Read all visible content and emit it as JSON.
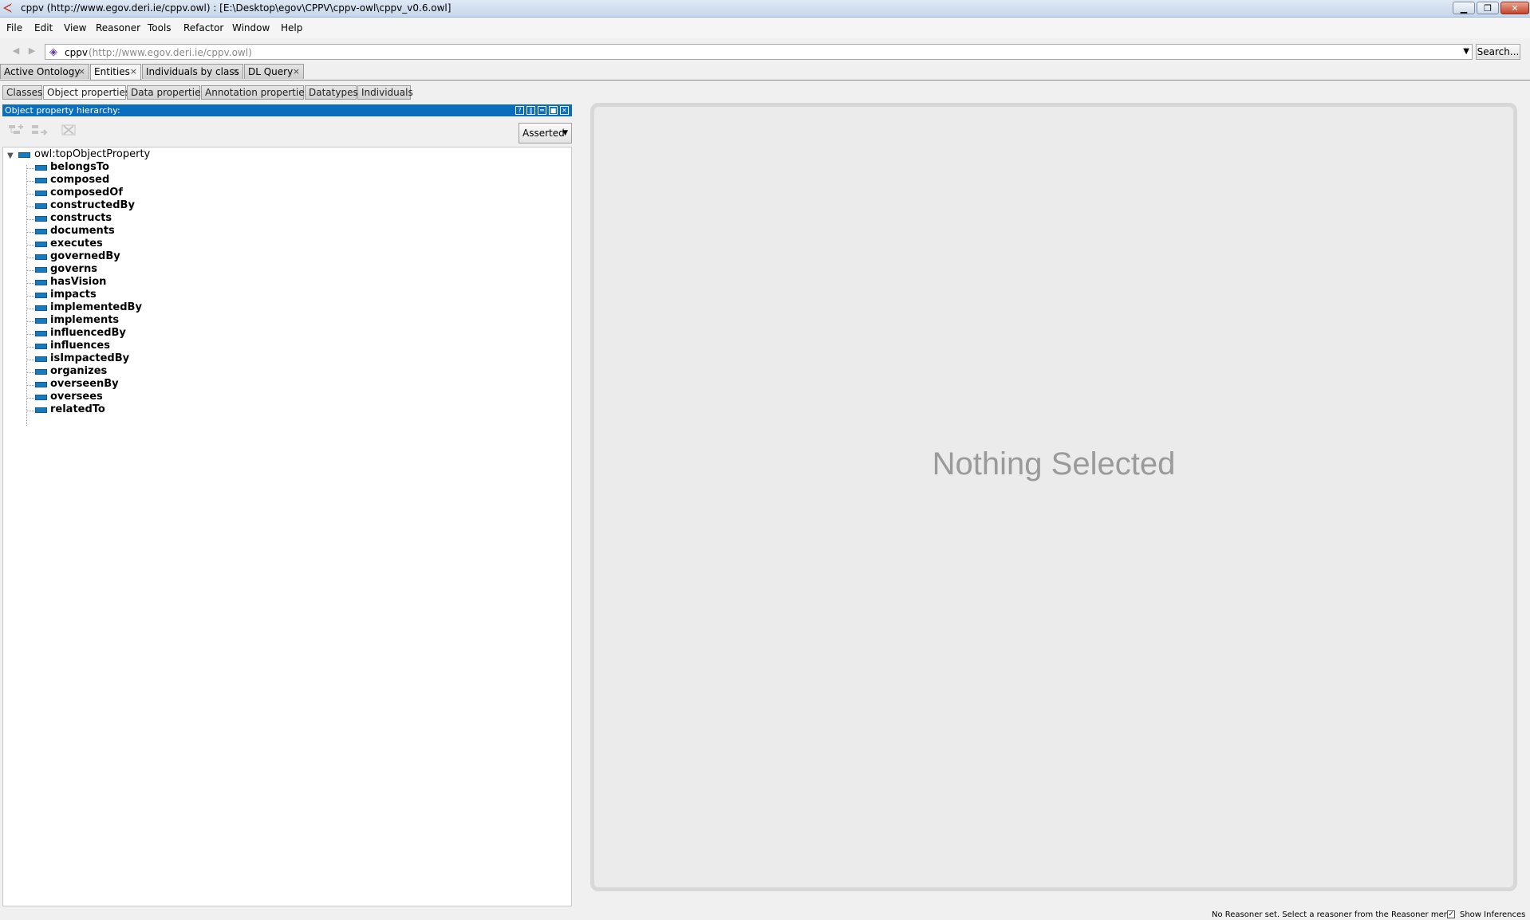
{
  "window": {
    "title": "cppv (http://www.egov.deri.ie/cppv.owl)  : [E:\\Desktop\\egov\\CPPV\\cppv-owl\\cppv_v0.6.owl]"
  },
  "menu": [
    "File",
    "Edit",
    "View",
    "Reasoner",
    "Tools",
    "Refactor",
    "Window",
    "Help"
  ],
  "nav": {
    "ontology_name": "cppv",
    "ontology_iri": "(http://www.egov.deri.ie/cppv.owl)",
    "search_label": "Search..."
  },
  "workspace_tabs": [
    {
      "label": "Active Ontology",
      "close": "×"
    },
    {
      "label": "Entities",
      "close": "×"
    },
    {
      "label": "Individuals by class",
      "close": "×"
    },
    {
      "label": "DL Query",
      "close": "×"
    }
  ],
  "view_tabs": [
    "Classes",
    "Object properties",
    "Data properties",
    "Annotation properties",
    "Datatypes",
    "Individuals"
  ],
  "hierarchy": {
    "title": "Object property hierarchy:",
    "mode": "Asserted",
    "root": "owl:topObjectProperty",
    "children": [
      "belongsTo",
      "composed",
      "composedOf",
      "constructedBy",
      "constructs",
      "documents",
      "executes",
      "governedBy",
      "governs",
      "hasVision",
      "impacts",
      "implementedBy",
      "implements",
      "influencedBy",
      "influences",
      "isImpactedBy",
      "organizes",
      "overseenBy",
      "oversees",
      "relatedTo"
    ]
  },
  "details": {
    "empty_message": "Nothing Selected"
  },
  "status": {
    "reasoner_message": "No Reasoner set. Select a reasoner from the Reasoner menu",
    "show_inferences_label": "Show Inferences",
    "show_inferences_checked": true
  },
  "colors": {
    "panel_header": "#0a6ebd",
    "property_icon": "#1779bf"
  }
}
